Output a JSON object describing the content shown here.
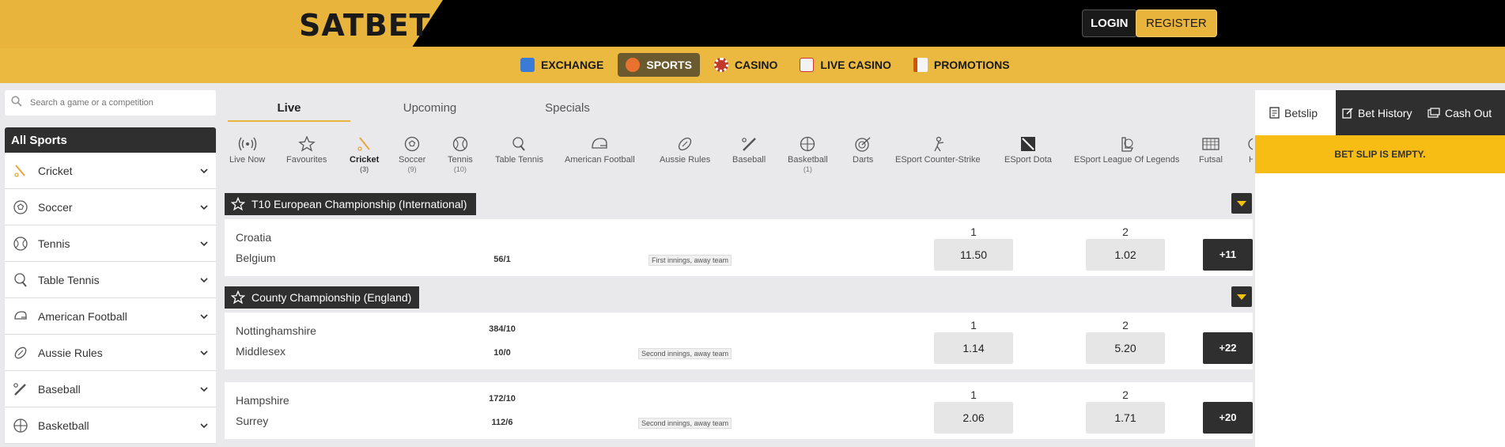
{
  "brand": {
    "logo": "SATBET"
  },
  "auth": {
    "login": "LOGIN",
    "register": "REGISTER"
  },
  "nav": [
    {
      "label": "EXCHANGE",
      "icon": "exchange-icon",
      "active": false
    },
    {
      "label": "SPORTS",
      "icon": "sports-icon",
      "active": true
    },
    {
      "label": "CASINO",
      "icon": "casino-chip-icon",
      "active": false
    },
    {
      "label": "LIVE CASINO",
      "icon": "cards-icon",
      "active": false
    },
    {
      "label": "PROMOTIONS",
      "icon": "megaphone-icon",
      "active": false
    }
  ],
  "search": {
    "placeholder": "Search a game or a competition"
  },
  "sidebar": {
    "title": "All Sports",
    "items": [
      {
        "label": "Cricket",
        "icon": "cricket-icon"
      },
      {
        "label": "Soccer",
        "icon": "soccer-icon"
      },
      {
        "label": "Tennis",
        "icon": "tennis-icon"
      },
      {
        "label": "Table Tennis",
        "icon": "table-tennis-icon"
      },
      {
        "label": "American Football",
        "icon": "american-football-icon"
      },
      {
        "label": "Aussie Rules",
        "icon": "aussie-rules-icon"
      },
      {
        "label": "Baseball",
        "icon": "baseball-icon"
      },
      {
        "label": "Basketball",
        "icon": "basketball-icon"
      }
    ]
  },
  "tabs": [
    {
      "label": "Live",
      "active": true
    },
    {
      "label": "Upcoming",
      "active": false
    },
    {
      "label": "Specials",
      "active": false
    }
  ],
  "sports_strip": [
    {
      "label": "Live Now",
      "count": "",
      "icon": "live-icon"
    },
    {
      "label": "Favourites",
      "count": "",
      "icon": "star-icon"
    },
    {
      "label": "Cricket",
      "count": "(3)",
      "icon": "cricket-icon",
      "active": true
    },
    {
      "label": "Soccer",
      "count": "(9)",
      "icon": "soccer-icon"
    },
    {
      "label": "Tennis",
      "count": "(10)",
      "icon": "tennis-icon"
    },
    {
      "label": "Table Tennis",
      "count": "",
      "icon": "table-tennis-icon"
    },
    {
      "label": "American Football",
      "count": "",
      "icon": "american-football-icon"
    },
    {
      "label": "Aussie Rules",
      "count": "",
      "icon": "aussie-rules-icon"
    },
    {
      "label": "Baseball",
      "count": "",
      "icon": "baseball-icon"
    },
    {
      "label": "Basketball",
      "count": "(1)",
      "icon": "basketball-icon"
    },
    {
      "label": "Darts",
      "count": "",
      "icon": "darts-icon"
    },
    {
      "label": "ESport Counter-Strike",
      "count": "",
      "icon": "counter-strike-icon"
    },
    {
      "label": "ESport Dota",
      "count": "",
      "icon": "dota-icon"
    },
    {
      "label": "ESport League Of Legends",
      "count": "",
      "icon": "lol-icon"
    },
    {
      "label": "Futsal",
      "count": "",
      "icon": "futsal-icon"
    },
    {
      "label": "Ha",
      "count": "",
      "icon": "handball-icon"
    }
  ],
  "leagues": [
    {
      "name": "T10 European Championship (International)",
      "events": [
        {
          "home": "Croatia",
          "away": "Belgium",
          "score_home": "",
          "score_away": "56/1",
          "status": "First innings, away team",
          "label1": "1",
          "label2": "2",
          "odd1": "11.50",
          "odd2": "1.02",
          "more": "+11"
        }
      ]
    },
    {
      "name": "County Championship (England)",
      "events": [
        {
          "home": "Nottinghamshire",
          "away": "Middlesex",
          "score_home": "384/10",
          "score_away": "10/0",
          "status": "Second innings, away team",
          "label1": "1",
          "label2": "2",
          "odd1": "1.14",
          "odd2": "5.20",
          "more": "+22"
        },
        {
          "home": "Hampshire",
          "away": "Surrey",
          "score_home": "172/10",
          "score_away": "112/6",
          "status": "Second innings, away team",
          "label1": "1",
          "label2": "2",
          "odd1": "2.06",
          "odd2": "1.71",
          "more": "+20"
        }
      ]
    }
  ],
  "betslip": {
    "tabs": [
      {
        "label": "Betslip",
        "icon": "receipt-icon",
        "active": true
      },
      {
        "label": "Bet History",
        "icon": "edit-icon",
        "active": false
      },
      {
        "label": "Cash Out",
        "icon": "cashout-icon",
        "active": false
      }
    ],
    "empty_message": "BET SLIP IS EMPTY."
  },
  "colors": {
    "gold": "#e8b43c",
    "dark": "#2f2f2f",
    "betslip_yellow": "#f7bd14"
  }
}
